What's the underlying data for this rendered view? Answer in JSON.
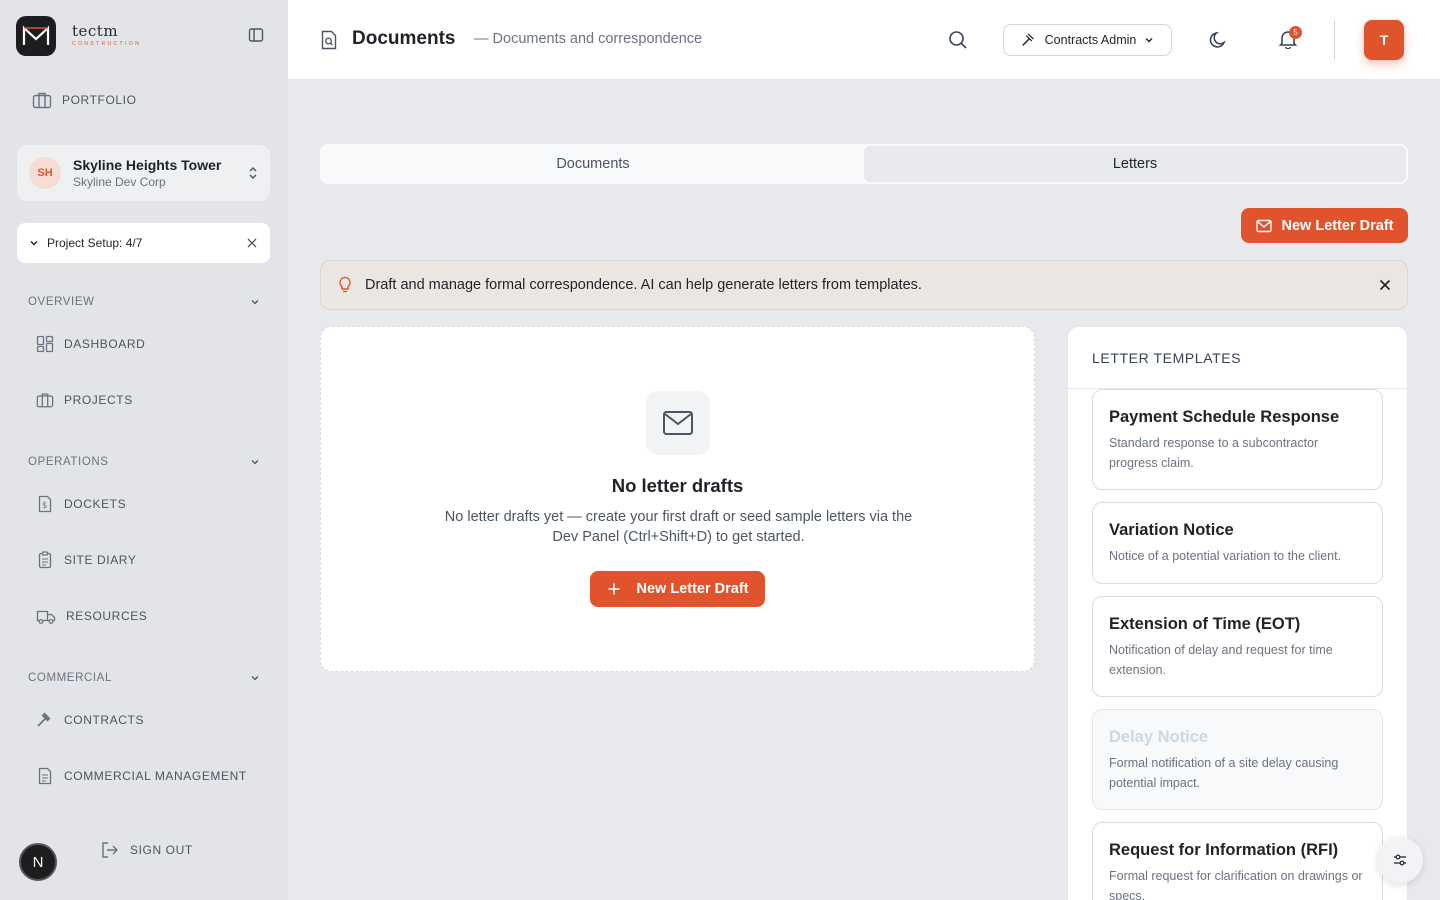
{
  "brand": {
    "name": "tectm",
    "tagline": "CONSTRUCTION"
  },
  "sidebar": {
    "portfolio_label": "PORTFOLIO",
    "project": {
      "initials": "SH",
      "name": "Skyline Heights Tower",
      "org": "Skyline Dev Corp"
    },
    "setup": {
      "label": "Project Setup: 4/7"
    },
    "sections": [
      {
        "title": "OVERVIEW",
        "items": [
          {
            "label": "DASHBOARD",
            "icon": "dashboard-icon"
          },
          {
            "label": "PROJECTS",
            "icon": "briefcase-icon"
          }
        ]
      },
      {
        "title": "OPERATIONS",
        "items": [
          {
            "label": "DOCKETS",
            "icon": "dollar-doc-icon"
          },
          {
            "label": "SITE DIARY",
            "icon": "clipboard-icon"
          },
          {
            "label": "RESOURCES",
            "icon": "truck-icon"
          }
        ]
      },
      {
        "title": "COMMERCIAL",
        "items": [
          {
            "label": "CONTRACTS",
            "icon": "gavel-icon"
          },
          {
            "label": "COMMERCIAL MANAGEMENT",
            "icon": "document-icon"
          }
        ]
      }
    ],
    "sign_out": "SIGN OUT",
    "dev_avatar": "N"
  },
  "header": {
    "title": "Documents",
    "subtitle": "— Documents and correspondence",
    "role": "Contracts Admin",
    "notifications": "5",
    "user_initial": "T"
  },
  "tabs": [
    {
      "label": "Documents",
      "active": false
    },
    {
      "label": "Letters",
      "active": true
    }
  ],
  "new_draft_label": "New Letter Draft",
  "banner": {
    "text": "Draft and manage formal correspondence. AI can help generate letters from templates."
  },
  "empty": {
    "title": "No letter drafts",
    "description": "No letter drafts yet — create your first draft or seed sample letters via the Dev Panel (Ctrl+Shift+D) to get started.",
    "button": "New Letter Draft"
  },
  "templates": {
    "heading": "LETTER TEMPLATES",
    "items": [
      {
        "title": "Payment Schedule Response",
        "description": "Standard response to a subcontractor progress claim."
      },
      {
        "title": "Variation Notice",
        "description": "Notice of a potential variation to the client."
      },
      {
        "title": "Extension of Time (EOT)",
        "description": "Notification of delay and request for time extension."
      },
      {
        "title": "Delay Notice",
        "description": "Formal notification of a site delay causing potential impact."
      },
      {
        "title": "Request for Information (RFI)",
        "description": "Formal request for clarification on drawings or specs."
      }
    ]
  },
  "colors": {
    "accent": "#e0532d",
    "sidebar_bg": "#e2e4e7",
    "page_bg": "#e7e9ec"
  }
}
